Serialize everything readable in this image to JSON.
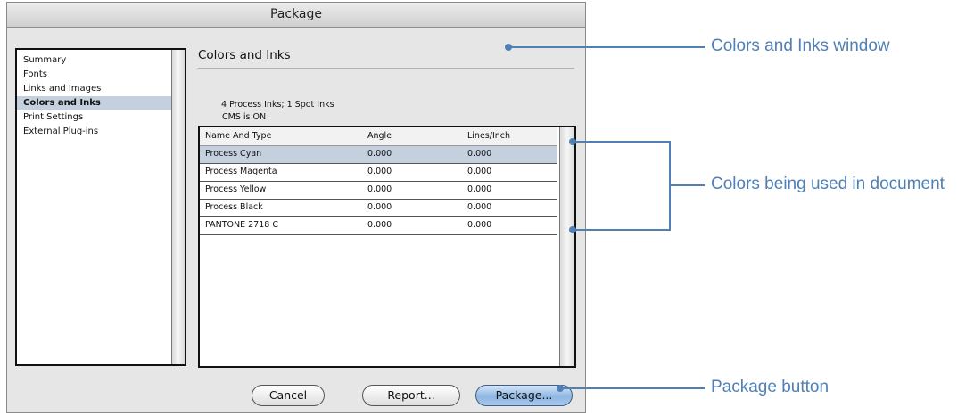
{
  "window": {
    "title": "Package"
  },
  "sidebar": {
    "items": [
      {
        "label": "Summary",
        "selected": false
      },
      {
        "label": "Fonts",
        "selected": false
      },
      {
        "label": "Links and Images",
        "selected": false
      },
      {
        "label": "Colors and Inks",
        "selected": true
      },
      {
        "label": "Print Settings",
        "selected": false
      },
      {
        "label": "External Plug-ins",
        "selected": false
      }
    ]
  },
  "main": {
    "section_title": "Colors and Inks",
    "summary_line1": "4 Process Inks; 1 Spot Inks",
    "summary_line2": "CMS is ON",
    "table": {
      "columns": [
        "Name And Type",
        "Angle",
        "Lines/Inch"
      ],
      "rows": [
        {
          "name": "Process Cyan",
          "angle": "0.000",
          "lines": "0.000",
          "selected": true
        },
        {
          "name": "Process Magenta",
          "angle": "0.000",
          "lines": "0.000",
          "selected": false
        },
        {
          "name": "Process Yellow",
          "angle": "0.000",
          "lines": "0.000",
          "selected": false
        },
        {
          "name": "Process Black",
          "angle": "0.000",
          "lines": "0.000",
          "selected": false
        },
        {
          "name": "PANTONE 2718 C",
          "angle": "0.000",
          "lines": "0.000",
          "selected": false
        }
      ]
    }
  },
  "buttons": {
    "cancel": "Cancel",
    "report": "Report...",
    "package": "Package..."
  },
  "annotations": {
    "colors_window": "Colors and Inks window",
    "colors_used": "Colors being used in document",
    "package_button": "Package button"
  },
  "colors": {
    "accent": "#4f7fb4",
    "selection": "#c5d0de"
  }
}
